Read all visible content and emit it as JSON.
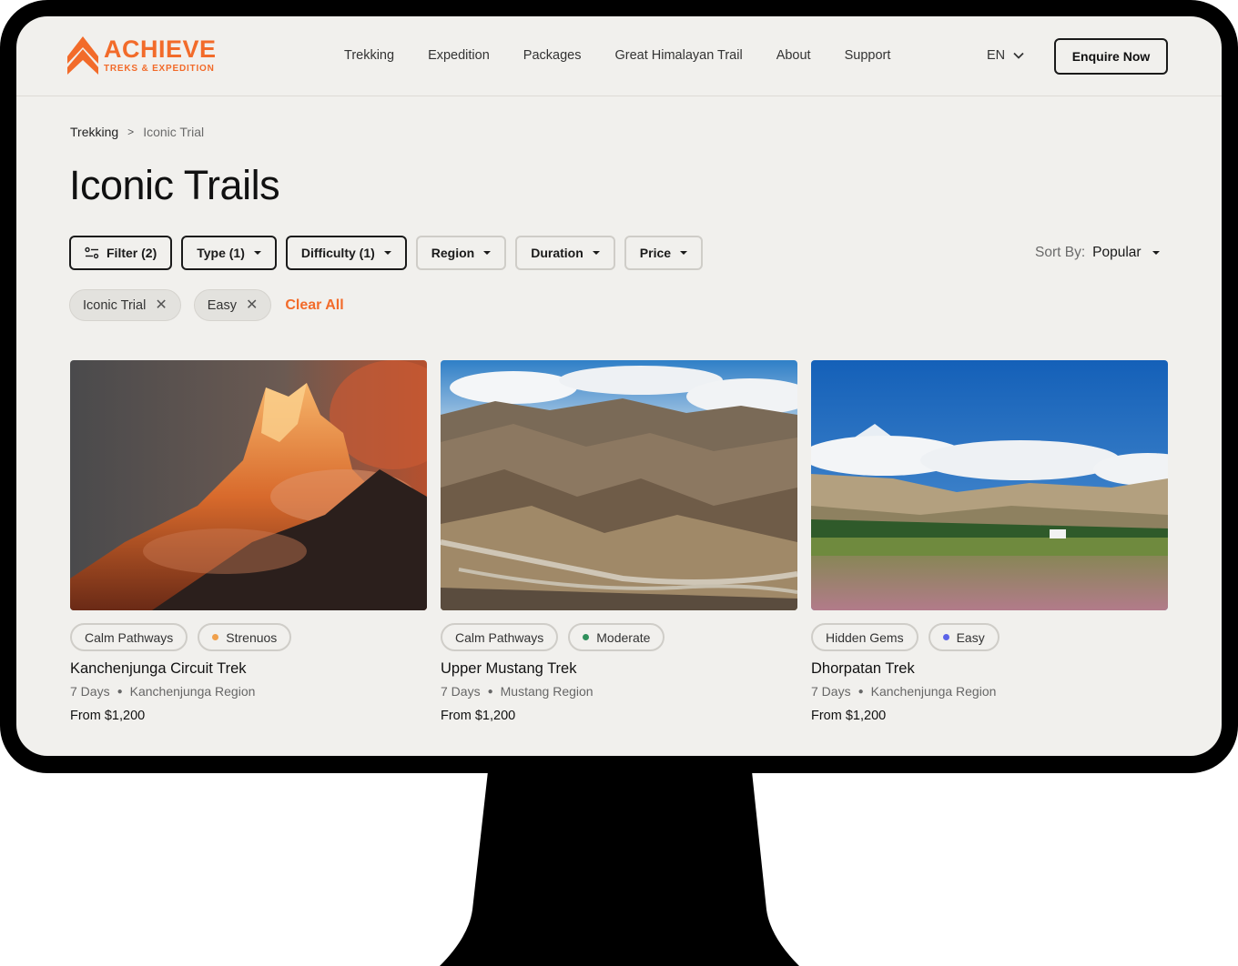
{
  "brand": {
    "name": "ACHIEVE",
    "tagline": "TREKS & EXPEDITION",
    "color": "#f26b2a"
  },
  "nav": {
    "items": [
      "Trekking",
      "Expedition",
      "Packages",
      "Great Himalayan Trail",
      "About",
      "Support"
    ]
  },
  "language": "EN",
  "enquire_label": "Enquire Now",
  "breadcrumb": {
    "parent": "Trekking",
    "separator": ">",
    "current": "Iconic Trial"
  },
  "page_title": "Iconic Trails",
  "filters": {
    "filter": "Filter (2)",
    "type": "Type (1)",
    "difficulty": "Difficulty (1)",
    "region": "Region",
    "duration": "Duration",
    "price": "Price"
  },
  "sort": {
    "label": "Sort By:",
    "value": "Popular"
  },
  "active_chips": [
    {
      "label": "Iconic Trial"
    },
    {
      "label": "Easy"
    }
  ],
  "clear_all": "Clear All",
  "treks": [
    {
      "category": "Calm Pathways",
      "difficulty": "Strenuos",
      "difficulty_color": "#f0a04b",
      "title": "Kanchenjunga Circuit Trek",
      "days": "7 Days",
      "region": "Kanchenjunga Region",
      "price": "From $1,200",
      "image": "sunset-mountain-peak"
    },
    {
      "category": "Calm Pathways",
      "difficulty": "Moderate",
      "difficulty_color": "#2f8f5b",
      "title": "Upper Mustang Trek",
      "days": "7 Days",
      "region": "Mustang Region",
      "price": "From $1,200",
      "image": "mustang-canyon-road"
    },
    {
      "category": "Hidden Gems",
      "difficulty": "Easy",
      "difficulty_color": "#5b63e8",
      "title": "Dhorpatan Trek",
      "days": "7 Days",
      "region": "Kanchenjunga Region",
      "price": "From $1,200",
      "image": "meadow-snow-peaks"
    }
  ]
}
